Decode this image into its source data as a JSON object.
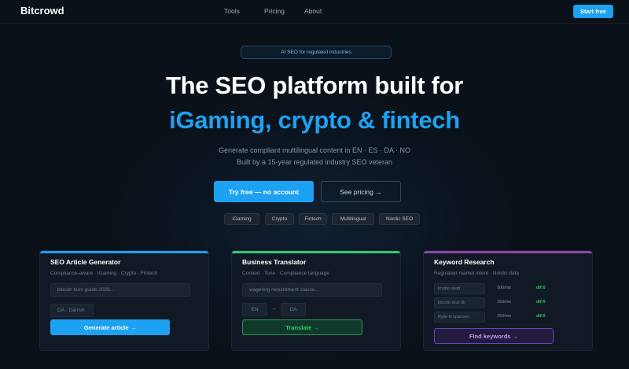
{
  "nav": {
    "logo": "Bitcrowd",
    "links": [
      "Tools",
      "Pricing",
      "About"
    ],
    "cta": "Start free"
  },
  "hero": {
    "badge": "AI SEO for regulated industries",
    "title_line1": "The SEO platform built for",
    "title_line2": "iGaming, crypto & fintech",
    "subtitle_line1": "Generate compliant multilingual content in EN · ES · DA · NO",
    "subtitle_line2": "Built by a 15-year regulated industry SEO veteran",
    "primary_cta": "Try free — no account",
    "secondary_cta": "See pricing →",
    "tags": [
      "iGaming",
      "Crypto",
      "Fintech",
      "Multilingual",
      "Nordic SEO"
    ]
  },
  "cards": {
    "article": {
      "title": "SEO Article Generator",
      "subtitle": "Compliance-aware · iGaming · Crypto · Fintech",
      "keyword_value": "bitcoin kurs guide 2026...",
      "language_value": "DA · Danish",
      "button": "Generate article →",
      "accent": "#1da1f2"
    },
    "translator": {
      "title": "Business Translator",
      "subtitle": "Context · Tone · Compliance language",
      "text_value": "wagering requirement clause...",
      "from_lang": "EN",
      "arrow": "→",
      "to_lang": "DA",
      "button": "Translate →",
      "accent": "#2ecc71"
    },
    "keywords": {
      "title": "Keyword Research",
      "subtitle": "Regulated market intent · Nordic data",
      "rows": [
        {
          "term": "krypto skatt",
          "volume": "200/mo",
          "dif": "dif:0"
        },
        {
          "term": "bitcoin skat dk",
          "volume": "150/mo",
          "dif": "dif:0"
        },
        {
          "term": "Rylle til spansen",
          "volume": "150/mo",
          "dif": "dif:0"
        }
      ],
      "button": "Find keywords →",
      "accent": "#8e44ad"
    }
  },
  "colors": {
    "background": "#0a1119",
    "accent_blue": "#1da1f2",
    "accent_green": "#2ecc71",
    "accent_purple": "#8e44ad"
  }
}
